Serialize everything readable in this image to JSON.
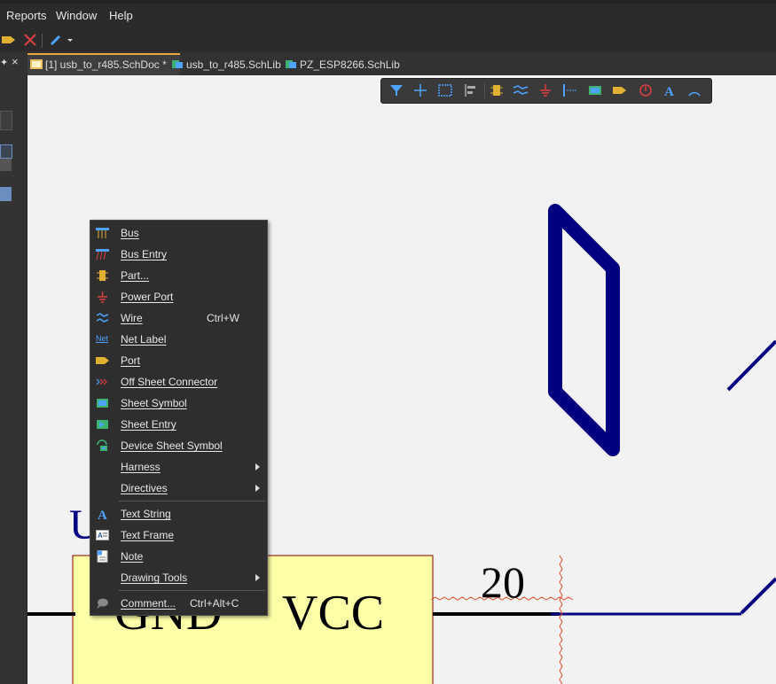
{
  "menubar": {
    "items": [
      {
        "label": "Reports",
        "underline": "R"
      },
      {
        "label": "Window",
        "underline": "W"
      },
      {
        "label": "Help",
        "underline": "H"
      }
    ]
  },
  "tabs": [
    {
      "label": "[1] usb_to_r485.SchDoc *",
      "active": true,
      "icon": "schdoc-icon"
    },
    {
      "label": "usb_to_r485.SchLib",
      "active": false,
      "icon": "schlib-icon"
    },
    {
      "label": "PZ_ESP8266.SchLib",
      "active": false,
      "icon": "schlib-icon"
    }
  ],
  "context_menu": {
    "items": [
      {
        "label": "Bus",
        "icon": "bus-icon"
      },
      {
        "label": "Bus Entry",
        "icon": "bus-entry-icon"
      },
      {
        "label": "Part...",
        "icon": "part-icon"
      },
      {
        "label": "Power Port",
        "icon": "power-port-icon"
      },
      {
        "label": "Wire",
        "icon": "wire-icon",
        "shortcut": "Ctrl+W"
      },
      {
        "label": "Net Label",
        "icon": "net-label-icon"
      },
      {
        "label": "Port",
        "icon": "port-icon"
      },
      {
        "label": "Off Sheet Connector",
        "icon": "off-sheet-connector-icon"
      },
      {
        "label": "Sheet Symbol",
        "icon": "sheet-symbol-icon"
      },
      {
        "label": "Sheet Entry",
        "icon": "sheet-entry-icon"
      },
      {
        "label": "Device Sheet Symbol",
        "icon": "device-sheet-symbol-icon"
      },
      {
        "label": "Harness",
        "submenu": true
      },
      {
        "label": "Directives",
        "submenu": true
      },
      {
        "label": "Text String",
        "icon": "text-string-icon"
      },
      {
        "label": "Text Frame",
        "icon": "text-frame-icon"
      },
      {
        "label": "Note",
        "icon": "note-icon"
      },
      {
        "label": "Drawing Tools",
        "submenu": true
      },
      {
        "label": "Comment...",
        "icon": "comment-icon",
        "shortcut": "Ctrl+Alt+C"
      }
    ]
  },
  "schematic": {
    "designator_partial": "U",
    "pin_left_label": "GND",
    "pin_right_label": "VCC",
    "pin_number": "20",
    "colors": {
      "wire": "#000080",
      "component_fill": "#ffffa8",
      "component_border": "#8b0000",
      "designator": "#000080"
    }
  },
  "net_label_icon_text": "Net"
}
